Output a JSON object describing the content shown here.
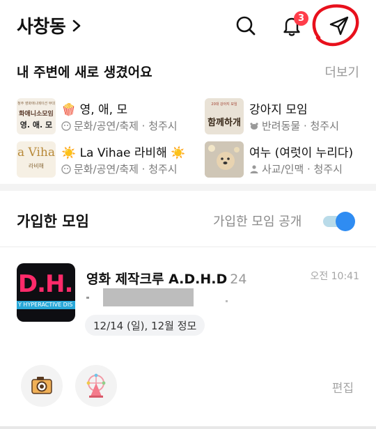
{
  "header": {
    "location": "사창동",
    "notification_count": "3"
  },
  "nearby": {
    "title": "내 주변에 새로 생겼어요",
    "more_label": "더보기",
    "items": [
      {
        "emoji_left": "🍿",
        "name": "영, 애, 모",
        "emoji_right": "",
        "category": "문화/공연/축제 · 청주시",
        "icon": "theater-icon",
        "thumb_text_top": "청주 영화애니메이션 무대",
        "thumb_text_mid": "화애니소모임",
        "thumb_text_bottom": "영. 애. 모"
      },
      {
        "emoji_left": "",
        "name": "강아지 모임",
        "emoji_right": "",
        "category": "반려동물 · 청주시",
        "icon": "pet-icon",
        "thumb_text_top": "20대 강아지 모임",
        "thumb_text_mid": "",
        "thumb_text_bottom": "함께하개"
      },
      {
        "emoji_left": "☀️",
        "name": "La Vihae 라비해",
        "emoji_right": "☀️",
        "category": "문화/공연/축제 · 청주시",
        "icon": "theater-icon",
        "thumb_text_top": "",
        "thumb_text_mid": "a Viha",
        "thumb_text_bottom": "라비해"
      },
      {
        "emoji_left": "",
        "name": "여누 (여럿이 누리다)",
        "emoji_right": "",
        "category": "사교/인맥 · 청주시",
        "icon": "people-icon",
        "thumb_text_top": "",
        "thumb_text_mid": "",
        "thumb_text_bottom": ""
      }
    ]
  },
  "joined": {
    "title": "가입한 모임",
    "public_label": "가입한 모임 공개",
    "public_enabled": true,
    "groups": [
      {
        "name": "영화 제작크루 A.D.H.D",
        "member_count": "24",
        "time": "오전 10:41",
        "meeting": "12/14 (일), 12월 정모",
        "thumb_big": ".D.H.",
        "thumb_small": "Y HYPERACTIVE DIS"
      }
    ]
  },
  "bottom": {
    "edit_label": "편집"
  },
  "colors": {
    "accent_blue": "#2f8cf2",
    "badge_red": "#ff3d4a",
    "annotation_red": "#e8101c"
  }
}
